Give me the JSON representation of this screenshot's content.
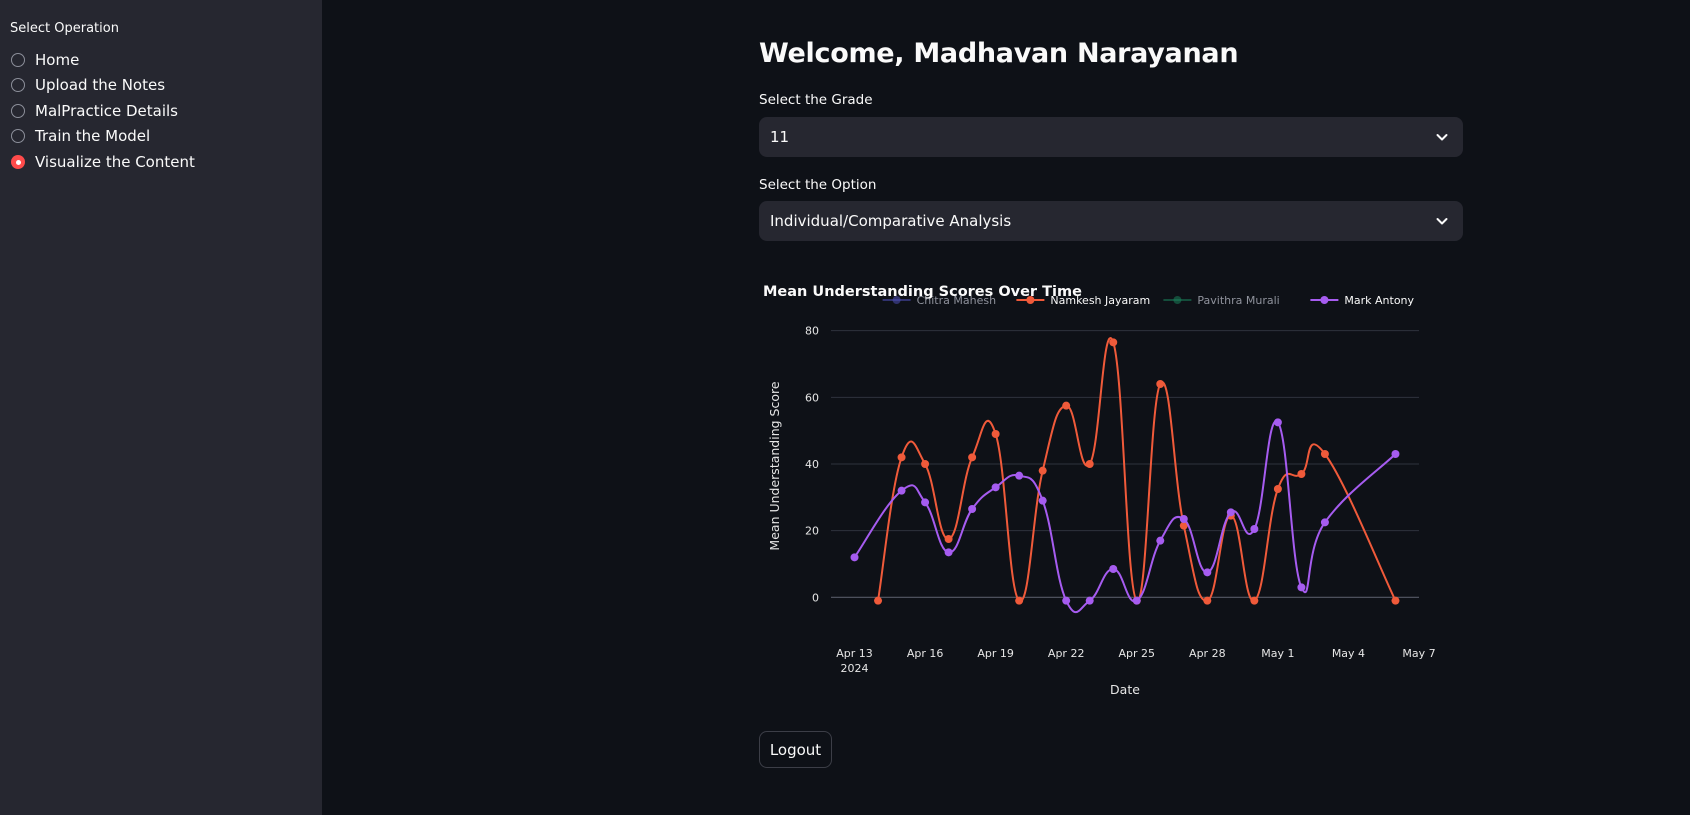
{
  "sidebar": {
    "label": "Select Operation",
    "items": [
      {
        "label": "Home",
        "selected": false
      },
      {
        "label": "Upload the Notes",
        "selected": false
      },
      {
        "label": "MalPractice Details",
        "selected": false
      },
      {
        "label": "Train the Model",
        "selected": false
      },
      {
        "label": "Visualize the Content",
        "selected": true
      }
    ]
  },
  "main": {
    "title": "Welcome, Madhavan Narayanan",
    "grade": {
      "label": "Select the Grade",
      "value": "11"
    },
    "option": {
      "label": "Select the Option",
      "value": "Individual/Comparative Analysis"
    },
    "logout_label": "Logout"
  },
  "colors": {
    "accent": "#ff4b4b"
  },
  "icons": {
    "select_chevron": "chevron-down-icon"
  },
  "chart_data": {
    "type": "line",
    "title": "Mean Understanding Scores Over Time",
    "xlabel": "Date",
    "ylabel": "Mean Understanding Score",
    "ylim": [
      -5,
      85
    ],
    "xlim": [
      "2024-04-12",
      "2024-05-07"
    ],
    "yticks": [
      0,
      20,
      40,
      60,
      80
    ],
    "xticks": [
      {
        "date": "2024-04-13",
        "label": "Apr 13",
        "sublabel": "2024"
      },
      {
        "date": "2024-04-16",
        "label": "Apr 16"
      },
      {
        "date": "2024-04-19",
        "label": "Apr 19"
      },
      {
        "date": "2024-04-22",
        "label": "Apr 22"
      },
      {
        "date": "2024-04-25",
        "label": "Apr 25"
      },
      {
        "date": "2024-04-28",
        "label": "Apr 28"
      },
      {
        "date": "2024-05-01",
        "label": "May 1"
      },
      {
        "date": "2024-05-04",
        "label": "May 4"
      },
      {
        "date": "2024-05-07",
        "label": "May 7"
      }
    ],
    "grid": true,
    "legend": "top-right",
    "series": [
      {
        "name": "Chitra Mahesh",
        "color": "#4c4eb5",
        "visible": false,
        "points": []
      },
      {
        "name": "Namkesh Jayaram",
        "color": "#f05a3a",
        "visible": true,
        "points": [
          [
            "2024-04-14",
            -1
          ],
          [
            "2024-04-15",
            42
          ],
          [
            "2024-04-16",
            40
          ],
          [
            "2024-04-17",
            17.5
          ],
          [
            "2024-04-18",
            42
          ],
          [
            "2024-04-19",
            49
          ],
          [
            "2024-04-20",
            -1
          ],
          [
            "2024-04-21",
            38
          ],
          [
            "2024-04-22",
            57.5
          ],
          [
            "2024-04-23",
            40
          ],
          [
            "2024-04-24",
            76.5
          ],
          [
            "2024-04-25",
            -1
          ],
          [
            "2024-04-26",
            64
          ],
          [
            "2024-04-27",
            21.5
          ],
          [
            "2024-04-28",
            -1
          ],
          [
            "2024-04-29",
            24.5
          ],
          [
            "2024-04-30",
            -1
          ],
          [
            "2024-05-01",
            32.5
          ],
          [
            "2024-05-02",
            37
          ],
          [
            "2024-05-03",
            43
          ],
          [
            "2024-05-06",
            -1
          ]
        ]
      },
      {
        "name": "Pavithra Murali",
        "color": "#1a7f5a",
        "visible": false,
        "points": []
      },
      {
        "name": "Mark Antony",
        "color": "#a65cf0",
        "visible": true,
        "points": [
          [
            "2024-04-13",
            12
          ],
          [
            "2024-04-15",
            32
          ],
          [
            "2024-04-16",
            28.5
          ],
          [
            "2024-04-17",
            13.5
          ],
          [
            "2024-04-18",
            26.5
          ],
          [
            "2024-04-19",
            33
          ],
          [
            "2024-04-20",
            36.5
          ],
          [
            "2024-04-21",
            29
          ],
          [
            "2024-04-22",
            -1
          ],
          [
            "2024-04-23",
            -1
          ],
          [
            "2024-04-24",
            8.5
          ],
          [
            "2024-04-25",
            -1
          ],
          [
            "2024-04-26",
            17
          ],
          [
            "2024-04-27",
            23.5
          ],
          [
            "2024-04-28",
            7.5
          ],
          [
            "2024-04-29",
            25.5
          ],
          [
            "2024-04-30",
            20.5
          ],
          [
            "2024-05-01",
            52.5
          ],
          [
            "2024-05-02",
            3
          ],
          [
            "2024-05-03",
            22.5
          ],
          [
            "2024-05-06",
            43
          ]
        ]
      }
    ]
  }
}
